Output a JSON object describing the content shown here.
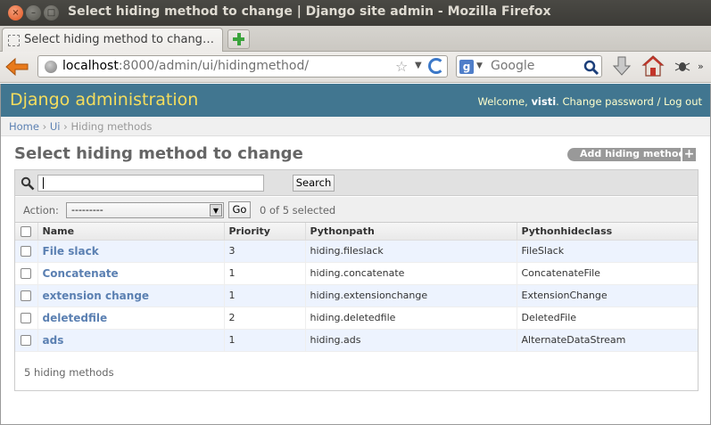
{
  "window": {
    "title": "Select hiding method to change | Django site admin - Mozilla Firefox",
    "close_glyph": "×",
    "min_glyph": "–",
    "max_glyph": "□"
  },
  "tabs": [
    {
      "label": "Select hiding method to chang…",
      "active": true
    }
  ],
  "nav": {
    "url_host": "localhost",
    "url_rest": ":8000/admin/ui/hidingmethod/",
    "search_engine_glyph": "g",
    "search_placeholder": "Google"
  },
  "header": {
    "brand": "Django administration",
    "welcome": "Welcome,",
    "username": "visti",
    "change_password": "Change password",
    "separator": "/",
    "logout": "Log out"
  },
  "breadcrumbs": {
    "home": "Home",
    "app": "Ui",
    "current": "Hiding methods",
    "sep": "›"
  },
  "content": {
    "title": "Select hiding method to change",
    "add_label": "Add hiding method",
    "add_glyph": "+"
  },
  "toolbar": {
    "search_value": "",
    "search_button": "Search"
  },
  "actions": {
    "label": "Action:",
    "selected_option": "---------",
    "go": "Go",
    "counter": "0 of 5 selected"
  },
  "table": {
    "headers": [
      "Name",
      "Priority",
      "Pythonpath",
      "Pythonhideclass"
    ],
    "rows": [
      {
        "name": "File slack",
        "priority": "3",
        "pythonpath": "hiding.fileslack",
        "pythonhideclass": "FileSlack"
      },
      {
        "name": "Concatenate",
        "priority": "1",
        "pythonpath": "hiding.concatenate",
        "pythonhideclass": "ConcatenateFile"
      },
      {
        "name": "extension change",
        "priority": "1",
        "pythonpath": "hiding.extensionchange",
        "pythonhideclass": "ExtensionChange"
      },
      {
        "name": "deletedfile",
        "priority": "2",
        "pythonpath": "hiding.deletedfile",
        "pythonhideclass": "DeletedFile"
      },
      {
        "name": "ads",
        "priority": "1",
        "pythonpath": "hiding.ads",
        "pythonhideclass": "AlternateDataStream"
      }
    ]
  },
  "paginator": {
    "text": "5 hiding methods"
  },
  "colors": {
    "header_bg": "#417690",
    "brand_color": "#f5dd5d",
    "link_color": "#5b80b2",
    "row_alt": "#edf3fe"
  }
}
